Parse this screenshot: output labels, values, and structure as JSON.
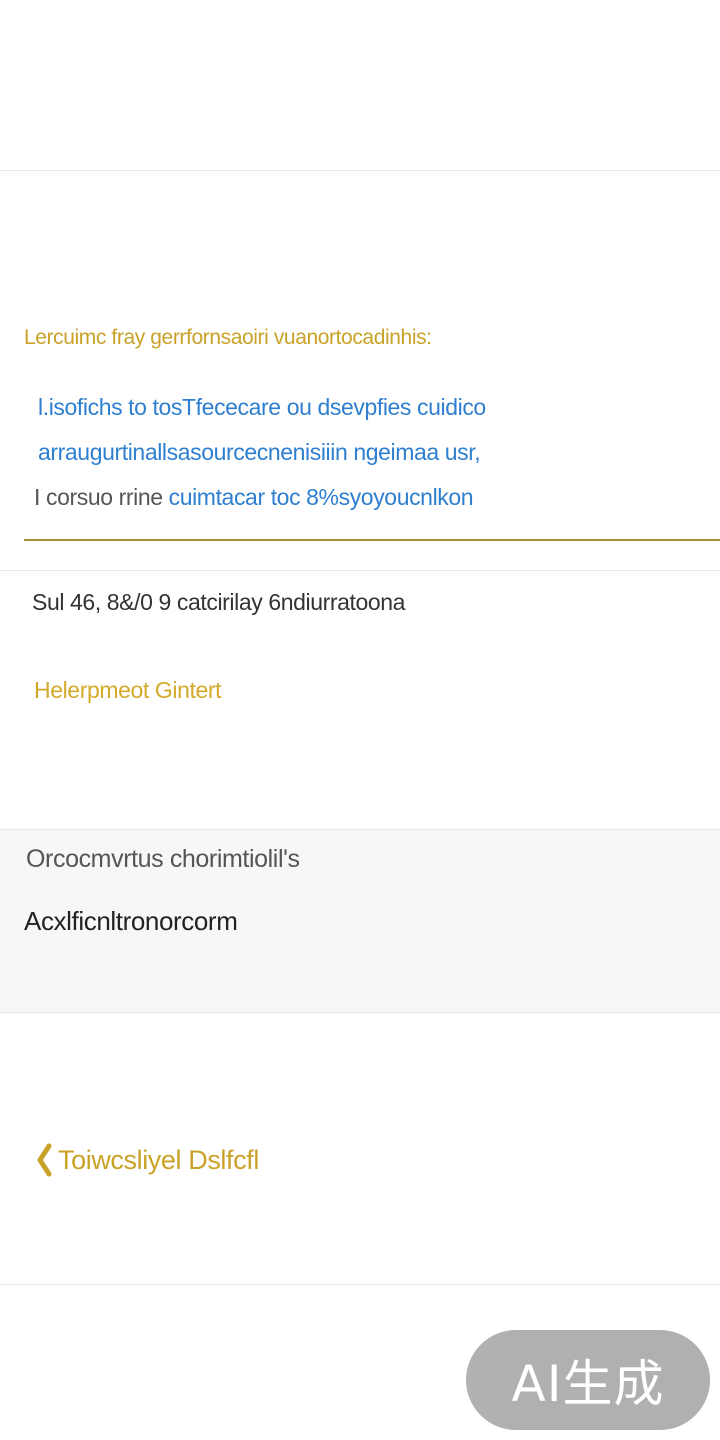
{
  "section": {
    "heading": "Lercuimc fray gerrfornsaoiri vuanortocadinhis:",
    "body_lines": [
      "l.isofichs to tosTfececare ou dsevpfies cuidico",
      "arraugurtinallsasourcecnenisiiin ngeimaa usr,",
      "cuimtacar toc 8%syoyoucnlkon"
    ],
    "body_line3_lead": "I corsuo rrine "
  },
  "summary": {
    "text": "Sul 46, 8&/0 9 catcirilay 6ndiurratoona"
  },
  "help_link": {
    "label": "Helerpmeot Gintert"
  },
  "panel": {
    "caption": "Orcocmvrtus chorimtiolil's",
    "value": "Acxlficnltronorcorm"
  },
  "back_button": {
    "label": "Toiwcsliyel Dslfcfl"
  },
  "watermark": {
    "text": "AI生成"
  },
  "colors": {
    "gold": "#c9a227",
    "blue": "#2f7fd0",
    "divider": "#a78e3a",
    "panel_bg": "#f7f7f9"
  }
}
